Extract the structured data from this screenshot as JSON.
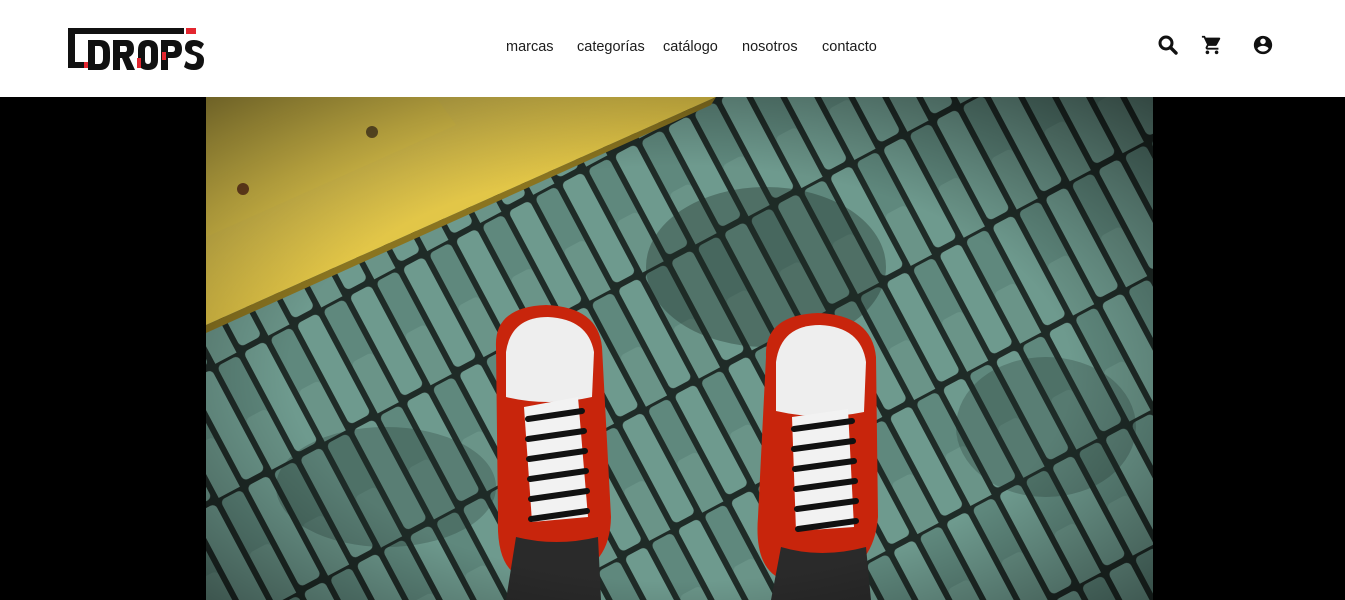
{
  "brand": {
    "logo_text": "DROPS",
    "accent_color": "#e3262f"
  },
  "nav": {
    "items": [
      {
        "label": "marcas"
      },
      {
        "label": "categorías"
      },
      {
        "label": "catálogo"
      },
      {
        "label": "nosotros"
      },
      {
        "label": "contacto"
      }
    ]
  },
  "actions": {
    "icons": [
      "search-icon",
      "cart-icon",
      "account-icon"
    ]
  },
  "hero": {
    "image_subject": "red-and-white high-top sneakers on green paving bricks beside a yellow curb",
    "background_color": "#000000"
  }
}
